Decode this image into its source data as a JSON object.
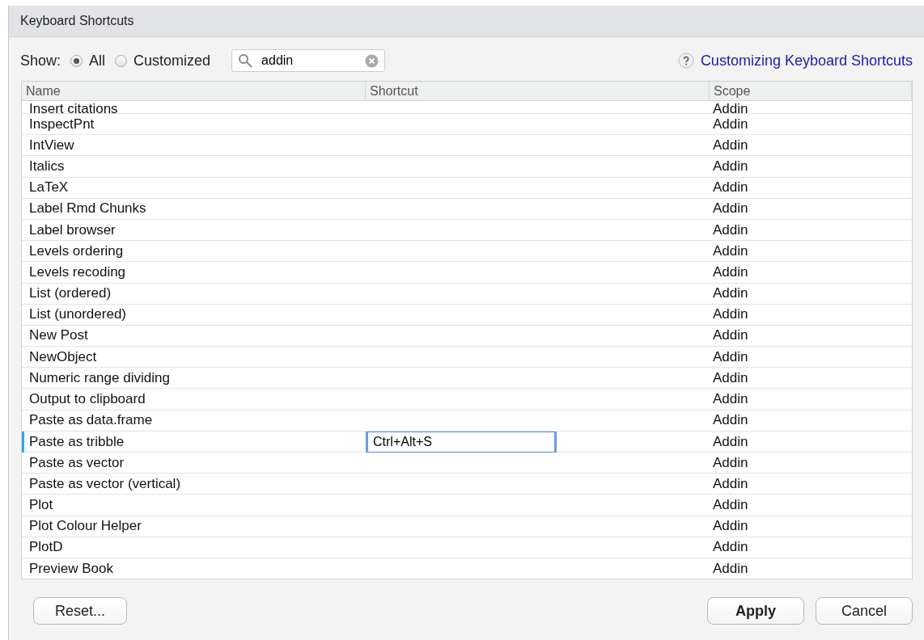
{
  "window": {
    "title": "Keyboard Shortcuts"
  },
  "filter": {
    "label": "Show:",
    "options": [
      {
        "label": "All",
        "selected": true
      },
      {
        "label": "Customized",
        "selected": false
      }
    ]
  },
  "search": {
    "value": "addin"
  },
  "help_link": "Customizing Keyboard Shortcuts",
  "table": {
    "columns": [
      "Name",
      "Shortcut",
      "Scope"
    ],
    "rows": [
      {
        "name": "Insert citations",
        "scope": "Addin",
        "selected": false
      },
      {
        "name": "InspectPnt",
        "scope": "Addin",
        "selected": false
      },
      {
        "name": "IntView",
        "scope": "Addin",
        "selected": false
      },
      {
        "name": "Italics",
        "scope": "Addin",
        "selected": false
      },
      {
        "name": "LaTeX",
        "scope": "Addin",
        "selected": false
      },
      {
        "name": "Label Rmd Chunks",
        "scope": "Addin",
        "selected": false
      },
      {
        "name": "Label browser",
        "scope": "Addin",
        "selected": false
      },
      {
        "name": "Levels ordering",
        "scope": "Addin",
        "selected": false
      },
      {
        "name": "Levels recoding",
        "scope": "Addin",
        "selected": false
      },
      {
        "name": "List (ordered)",
        "scope": "Addin",
        "selected": false
      },
      {
        "name": "List (unordered)",
        "scope": "Addin",
        "selected": false
      },
      {
        "name": "New Post",
        "scope": "Addin",
        "selected": false
      },
      {
        "name": "NewObject",
        "scope": "Addin",
        "selected": false
      },
      {
        "name": "Numeric range dividing",
        "scope": "Addin",
        "selected": false
      },
      {
        "name": "Output to clipboard",
        "scope": "Addin",
        "selected": false
      },
      {
        "name": "Paste as data.frame",
        "scope": "Addin",
        "selected": false
      },
      {
        "name": "Paste as tribble",
        "shortcut": "Ctrl+Alt+S",
        "scope": "Addin",
        "selected": true
      },
      {
        "name": "Paste as vector",
        "scope": "Addin",
        "selected": false
      },
      {
        "name": "Paste as vector (vertical)",
        "scope": "Addin",
        "selected": false
      },
      {
        "name": "Plot",
        "scope": "Addin",
        "selected": false
      },
      {
        "name": "Plot Colour Helper",
        "scope": "Addin",
        "selected": false
      },
      {
        "name": "PlotD",
        "scope": "Addin",
        "selected": false
      },
      {
        "name": "Preview Book",
        "scope": "Addin",
        "selected": false
      }
    ]
  },
  "buttons": {
    "left": [
      "Reset..."
    ],
    "right": [
      "Apply",
      "Cancel"
    ]
  }
}
